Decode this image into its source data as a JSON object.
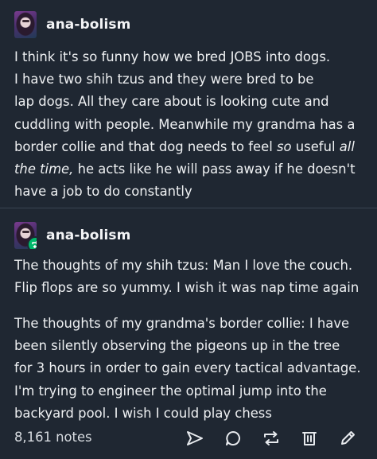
{
  "post": {
    "author": {
      "username": "ana-bolism"
    },
    "paragraph_lines": [
      "I think it's so funny how we bred JOBS into dogs.",
      "I have two shih tzus and they were bred to be",
      "lap dogs. All they care about is looking cute and",
      "cuddling with people. Meanwhile my grandma has a",
      "border collie and that dog needs to feel",
      "so",
      "useful",
      "all",
      "the time,",
      "he acts like he will pass away if he doesn't",
      "have a job to do constantly"
    ]
  },
  "reblog": {
    "author": {
      "username": "ana-bolism"
    },
    "para1_lines": [
      "The thoughts of my shih tzus: Man I love the couch.",
      "Flip flops are so yummy. I wish it was nap time again"
    ],
    "para2_lines": [
      "The thoughts of my grandma's border collie: I have",
      "been silently observing the pigeons up in the tree",
      "for 3 hours in order to gain every tactical advantage.",
      "I'm trying to engineer the optimal jump into the",
      "backyard pool. I wish I could play chess"
    ]
  },
  "footer": {
    "notes_label": "8,161 notes",
    "actions": [
      "share-icon",
      "comment-icon",
      "reblog-icon",
      "delete-icon",
      "edit-icon"
    ]
  },
  "colors": {
    "background": "#1f2732",
    "text": "#eef0f2",
    "reblog_badge": "#00b86b"
  }
}
